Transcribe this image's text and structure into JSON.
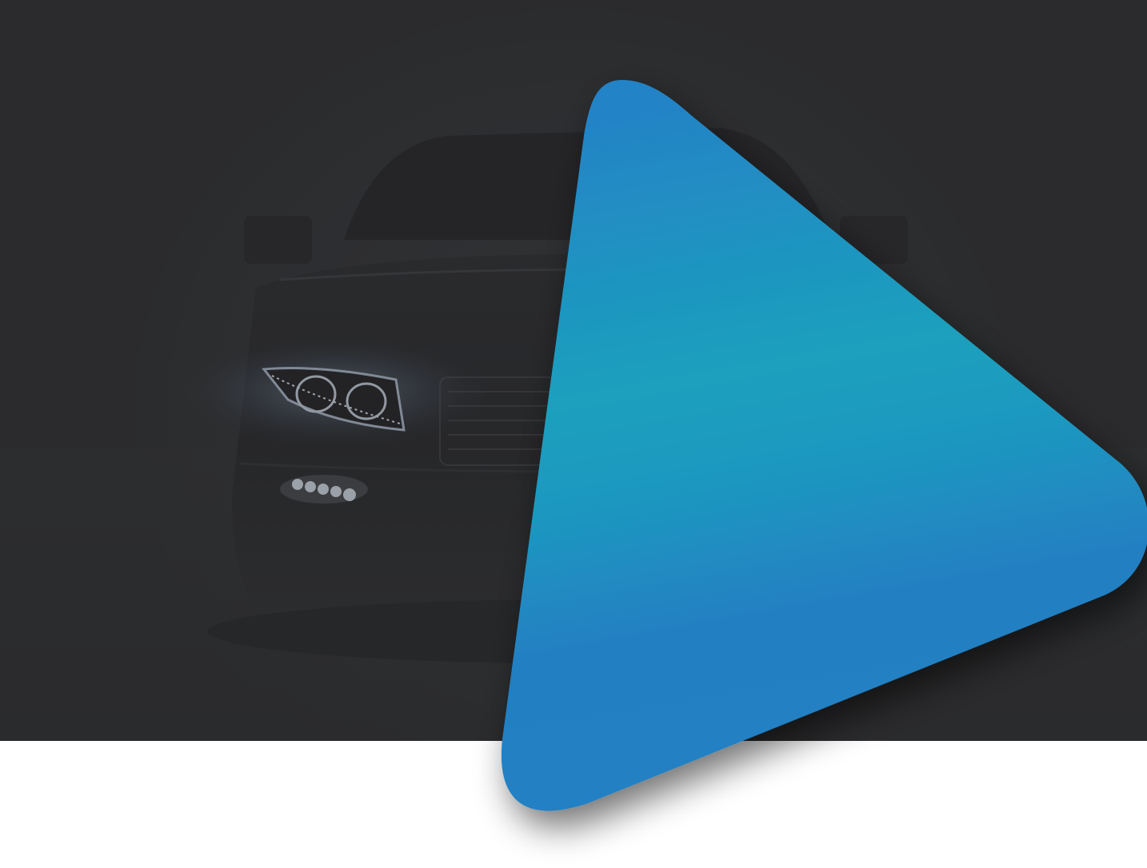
{
  "colors": {
    "background_dark": "#2b2c2d",
    "page_white": "#ffffff",
    "play_blue_top": "#2283c6",
    "play_teal_mid": "#1da0bd",
    "play_blue_bottom": "#227fc2",
    "headlight_glow": "#cdd8e6"
  },
  "hero": {
    "subject": "car-front-silhouette"
  },
  "icons": {
    "play": "play-icon"
  }
}
